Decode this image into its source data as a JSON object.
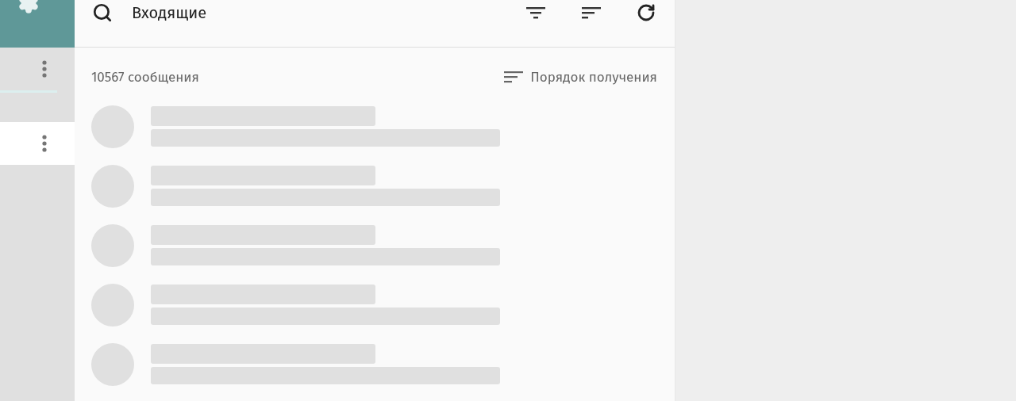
{
  "sidebar": {
    "items": [
      {
        "selected": false
      },
      {
        "selected": true
      }
    ]
  },
  "header": {
    "title": "Входящие"
  },
  "list": {
    "count": "10567 сообщения",
    "sort_label": "Порядок получения"
  }
}
